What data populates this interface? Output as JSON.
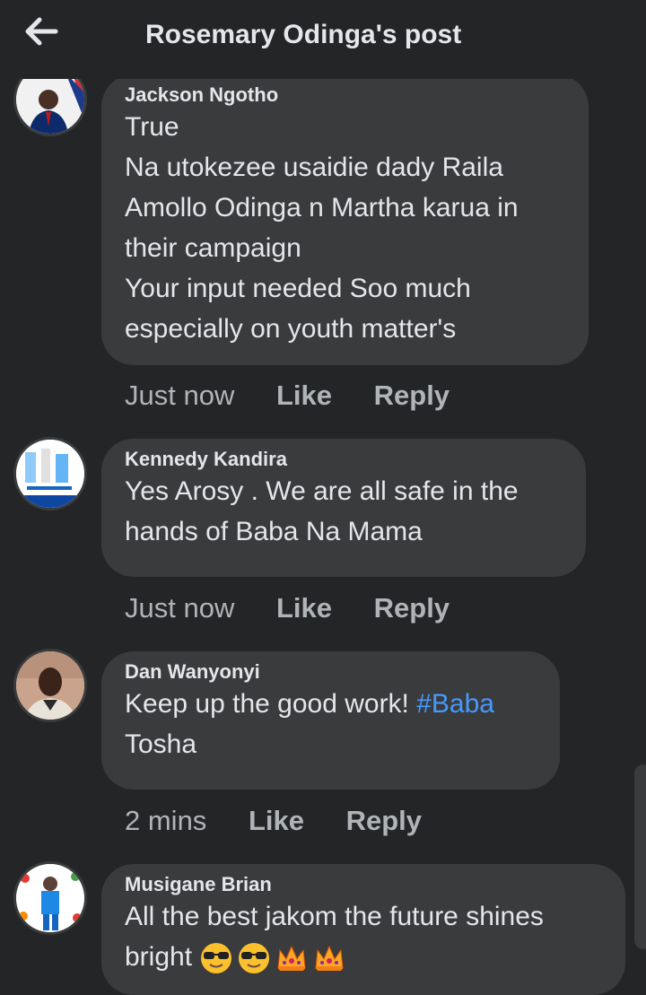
{
  "header": {
    "back_icon": "arrow-left-icon",
    "title": "Rosemary Odinga's post"
  },
  "actions_labels": {
    "like": "Like",
    "reply": "Reply"
  },
  "colors": {
    "background": "#242526",
    "bubble": "#3a3b3c",
    "hashtag": "#4599ff",
    "meta": "#b0b3b8"
  },
  "comments": [
    {
      "name": "Jackson Ngotho",
      "lines": [
        "True",
        "Na utokezee usaidie dady Raila",
        "Amollo Odinga n Martha karua in",
        "their campaign",
        "Your input needed Soo much",
        "especially on youth matter's"
      ],
      "time": "Just now"
    },
    {
      "name": "Kennedy Kandira",
      "lines": [
        "Yes Arosy . We are all safe in the",
        "hands of Baba Na Mama"
      ],
      "time": "Just now"
    },
    {
      "name": "Dan Wanyonyi",
      "line1_text": "Keep up the good work! ",
      "hashtag": "#Baba",
      "line2": "Tosha",
      "time": "2 mins"
    },
    {
      "name": "Musigane Brian",
      "line1": "All the best jakom the future shines",
      "line2": "bright",
      "emojis": [
        "sunglasses-emoji",
        "sunglasses-emoji",
        "crown-emoji",
        "crown-emoji"
      ]
    }
  ]
}
